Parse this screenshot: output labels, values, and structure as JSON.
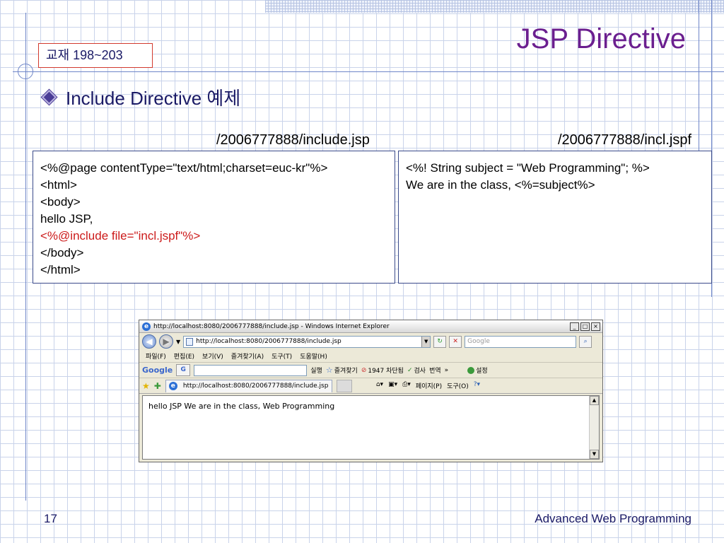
{
  "slide": {
    "title": "JSP Directive",
    "textbook_ref": "교재 198~203",
    "bullet": "Include Directive 예제",
    "left_path": "/2006777888/include.jsp",
    "right_path": "/2006777888/incl.jspf",
    "left_code": [
      "<%@page contentType=\"text/html;charset=euc-kr\"%>",
      "<html>",
      "<body>",
      "hello JSP,",
      "<%@include file=\"incl.jspf\"%>",
      "</body>",
      "</html>"
    ],
    "highlight_color": "#cc1a1a",
    "right_code": [
      "<%! String subject = \"Web Programming\"; %>",
      "We are in the class, <%=subject%>"
    ],
    "page_number": "17",
    "footer": "Advanced Web Programming"
  },
  "browser": {
    "window_title": "http://localhost:8080/2006777888/include.jsp - Windows Internet Explorer",
    "address": "http://localhost:8080/2006777888/include.jsp",
    "search_placeholder": "Google",
    "menu": [
      "파일(F)",
      "편집(E)",
      "보기(V)",
      "즐겨찾기(A)",
      "도구(T)",
      "도움말(H)"
    ],
    "google_bar": {
      "logo": "Google",
      "g_button": "G",
      "search_label": "실행",
      "favorites": "즐겨찾기",
      "blocked": "1947 차단됨",
      "check": "검사",
      "translate": "번역",
      "more": "»",
      "settings": "설정"
    },
    "tab_title": "http://localhost:8080/2006777888/include.jsp",
    "command_bar": [
      "페이지(P)",
      "도구(O)"
    ],
    "page_content": "hello JSP We are in the class, Web Programming"
  }
}
